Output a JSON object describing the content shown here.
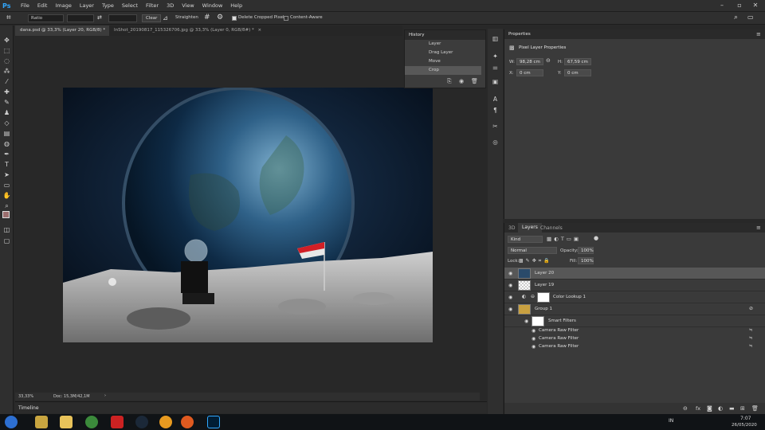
{
  "app": {
    "logo": "Ps",
    "accent": "#31a8ff"
  },
  "menu": [
    "File",
    "Edit",
    "Image",
    "Layer",
    "Type",
    "Select",
    "Filter",
    "3D",
    "View",
    "Window",
    "Help"
  ],
  "options": {
    "ratio": "Ratio",
    "clear": "Clear",
    "straighten": "Straighten",
    "delete_cropped": "Delete Cropped Pixels",
    "content_aware": "Content-Aware"
  },
  "tabs": [
    {
      "label": "dana.psd @ 33,3% (Layer 20, RGB/8) *",
      "close": "×"
    },
    {
      "label": "InShot_20190817_115326706.jpg @ 33,3% (Layer 0, RGB/8#) *",
      "close": "×"
    }
  ],
  "status": {
    "zoom": "33,33%",
    "doc": "Doc: 15,3M/42,1M"
  },
  "timeline": {
    "label": "Timeline"
  },
  "history": {
    "title": "History",
    "items": [
      "Layer",
      "Drag Layer",
      "Move",
      "Crop"
    ]
  },
  "properties": {
    "title": "Properties",
    "subtitle": "Pixel Layer Properties",
    "w_label": "W:",
    "w_value": "98,28 cm",
    "h_label": "H:",
    "h_value": "67,59 cm",
    "x_label": "X:",
    "x_value": "0 cm",
    "y_label": "Y:",
    "y_value": "0 cm"
  },
  "layers_panel": {
    "tabs": [
      "3D",
      "Layers",
      "Channels"
    ],
    "kind": "Kind",
    "blend": "Normal",
    "opacity_label": "Opacity:",
    "opacity_value": "100%",
    "lock_label": "Lock:",
    "fill_label": "Fill:",
    "fill_value": "100%",
    "rows": [
      {
        "name": "Layer 20"
      },
      {
        "name": "Layer 19"
      },
      {
        "name": "Color Lookup 1"
      },
      {
        "name": "Group 1"
      },
      {
        "name": "Smart Filters"
      },
      {
        "name": "Camera Raw Filter"
      },
      {
        "name": "Camera Raw Filter"
      },
      {
        "name": "Camera Raw Filter"
      }
    ]
  },
  "taskbar": {
    "lang": "IN",
    "time": "7:07",
    "date": "26/05/2020"
  }
}
